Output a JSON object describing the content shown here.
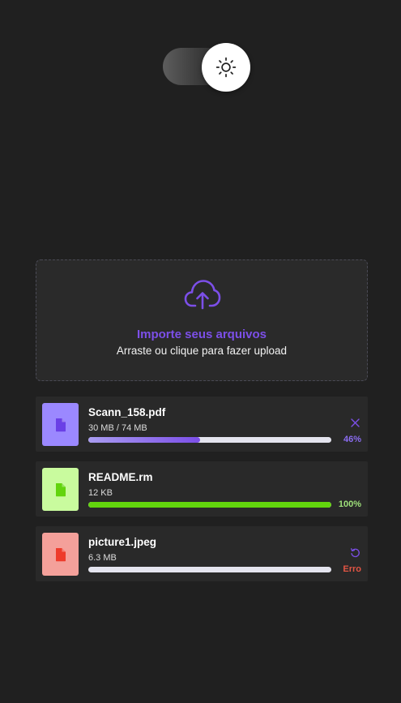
{
  "theme_toggle": {
    "icon": "sun-icon"
  },
  "upload": {
    "icon": "cloud-upload-icon",
    "title": "Importe seus arquivos",
    "subtitle": "Arraste ou clique para fazer upload",
    "accent": "#7c4fe8"
  },
  "files": [
    {
      "name": "Scann_158.pdf",
      "size": "30 MB / 74 MB",
      "progress": 0.46,
      "status": "46%",
      "status_color": "#8a6cf0",
      "bar_color": "#7c4fe8",
      "thumb_bg": "#9b88ff",
      "icon_color": "#6a3fe6",
      "action_icon": "close-icon",
      "action_color": "#7c4fe8"
    },
    {
      "name": "README.rm",
      "size": "12 KB",
      "progress": 1.0,
      "status": "100%",
      "status_color": "#9ee07a",
      "bar_color": "#62d40d",
      "thumb_bg": "#c9fb9e",
      "icon_color": "#62d40d",
      "action_icon": "",
      "action_color": ""
    },
    {
      "name": "picture1.jpeg",
      "size": "6.3 MB",
      "progress": 0.0,
      "status": "Erro",
      "status_color": "#e25544",
      "bar_color": "#e25544",
      "thumb_bg": "#f4a09a",
      "icon_color": "#ee3b2b",
      "action_icon": "retry-icon",
      "action_color": "#7c4fe8"
    }
  ]
}
